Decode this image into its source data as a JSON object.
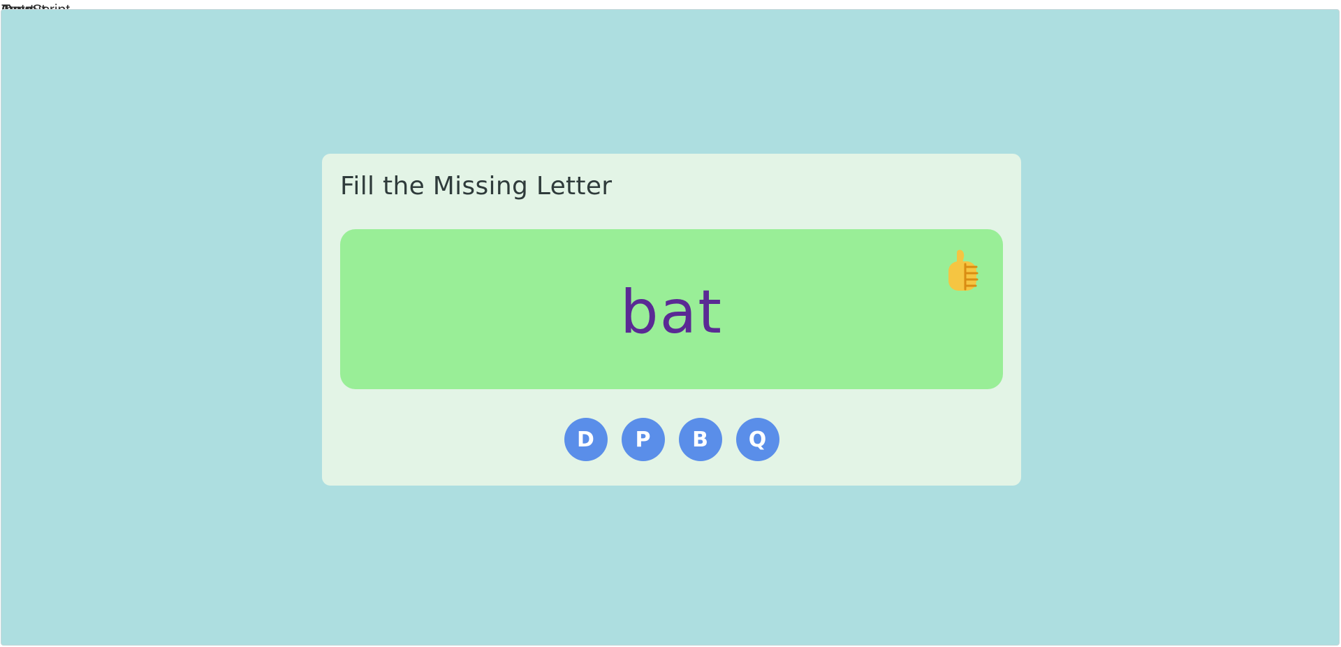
{
  "header": {
    "overlapping_labels": [
      "Input",
      "Output",
      "Type",
      "JavaScript"
    ]
  },
  "card": {
    "title": "Fill the Missing Letter",
    "word": "bat",
    "feedback_icon": "thumbs-up-icon"
  },
  "letter_options": [
    {
      "label": "D"
    },
    {
      "label": "P"
    },
    {
      "label": "B"
    },
    {
      "label": "Q"
    }
  ],
  "colors": {
    "background": "#addee0",
    "card": "#e3f4e6",
    "word_panel": "#99ee97",
    "word_text": "#5a2a94",
    "button": "#5a8ee9"
  }
}
